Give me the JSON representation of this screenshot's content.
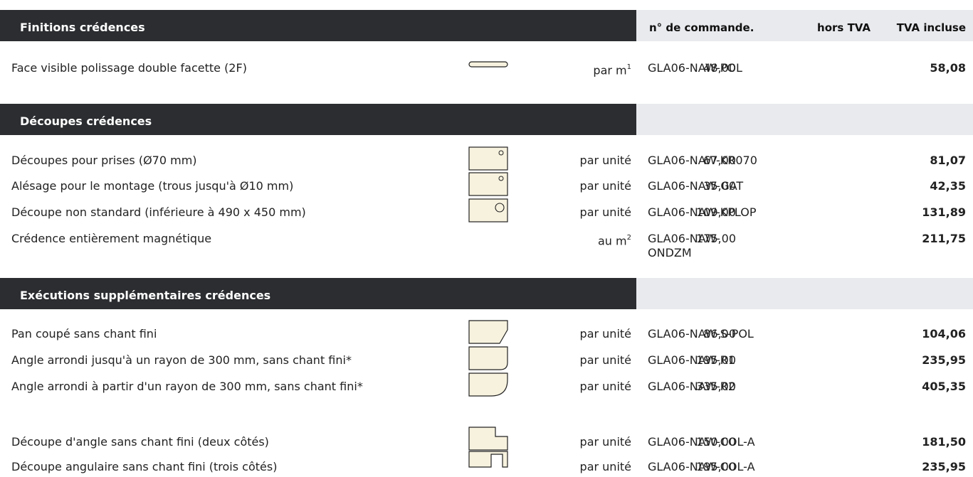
{
  "colors": {
    "header_dark": "#2b2d30",
    "header_light": "#e9eaee",
    "thumb_fill": "#f7f2de"
  },
  "columns": {
    "code": "n° de commande.",
    "hors_tva": "hors TVA",
    "tva_incluse": "TVA incluse"
  },
  "sections": [
    {
      "title": "Finitions crédences",
      "rows": [
        {
          "desc": "Face visible polissage double facette (2F)",
          "unit": "par m",
          "unit_sup": "1",
          "code": "GLA06-NAW-POL",
          "hors": "48,00",
          "ttc": "58,08",
          "icon": "edge-polish-icon"
        }
      ]
    },
    {
      "title": "Découpes crédences",
      "rows": [
        {
          "desc": "Découpes pour prises (Ø70 mm)",
          "unit": "par unité",
          "code": "GLA06-NAW-KR070",
          "hors": "67,00",
          "ttc": "81,07",
          "icon": "small-hole-icon"
        },
        {
          "desc": "Alésage pour le montage (trous jusqu'à Ø10 mm)",
          "unit": "par unité",
          "code": "GLA06-NAW-GAT",
          "hors": "35,00",
          "ttc": "42,35",
          "icon": "small-hole-icon"
        },
        {
          "desc": "Découpe non standard (inférieure à 490 x 450 mm)",
          "unit": "par unité",
          "code": "GLA06-NAW-KPLOP",
          "hors": "109,00",
          "ttc": "131,89",
          "icon": "large-hole-icon"
        },
        {
          "desc": "Crédence entièrement magnétique",
          "unit": "au m",
          "unit_sup": "2",
          "code": "GLA06-NAW-",
          "code_line2": "ONDZM",
          "hors": "175,00",
          "ttc": "211,75"
        }
      ]
    },
    {
      "title": "Exécutions supplémentaires crédences",
      "rows": [
        {
          "desc": "Pan coupé sans chant fini",
          "unit": "par unité",
          "code": "GLA06-NAW-S-POL",
          "hors": "86,00",
          "ttc": "104,06",
          "icon": "chamfer-corner-icon"
        },
        {
          "desc": "Angle arrondi jusqu'à un rayon de 300 mm, sans chant fini*",
          "unit": "par unité",
          "code": "GLA06-NAW-R1",
          "hors": "195,00",
          "ttc": "235,95",
          "icon": "rounded-corner-small-icon"
        },
        {
          "desc": "Angle arrondi à partir d'un rayon de 300 mm, sans chant fini*",
          "unit": "par unité",
          "code": "GLA06-NAW-R2",
          "hors": "335,00",
          "ttc": "405,35",
          "icon": "rounded-corner-large-icon"
        },
        {
          "desc": "Découpe d'angle sans chant fini (deux côtés)",
          "unit": "par unité",
          "code": "GLA06-NAW-COL-A",
          "hors": "150,00",
          "ttc": "181,50",
          "icon": "corner-notch-icon"
        },
        {
          "desc": "Découpe angulaire sans chant fini (trois côtés)",
          "unit": "par unité",
          "code": "GLA06-NAW-COL-A",
          "hors": "195,00",
          "ttc": "235,95",
          "icon": "u-notch-icon"
        }
      ]
    }
  ]
}
